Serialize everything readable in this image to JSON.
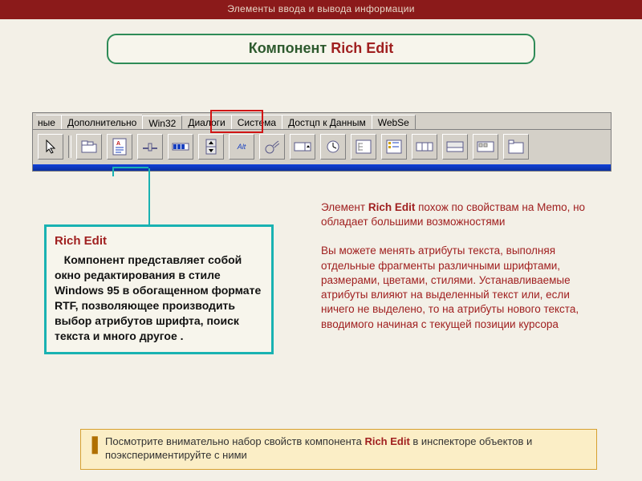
{
  "topbar": "Элементы ввода и вывода информации",
  "title": {
    "part1": "Компонент ",
    "part2": "Rich Edit"
  },
  "tabs": {
    "t0": "ные",
    "t1": "Дополнительно",
    "t2": "Win32",
    "t3": "Диалоги",
    "t4": "Система",
    "t5": "Достцп к Данным",
    "t6": "WebSe"
  },
  "toolbar_icons": [
    "cursor-icon",
    "tab-control-icon",
    "richedit-icon",
    "trackbar-icon",
    "progressbar-icon",
    "updown-icon",
    "hotkey-icon",
    "animate-icon",
    "datetime-icon",
    "monthcal-icon",
    "treeview-icon",
    "listview-icon",
    "header-icon",
    "statusbar-icon",
    "toolbar-icon",
    "pagecontrol-icon"
  ],
  "desc": {
    "heading": "Rich Edit",
    "body": "Компонент представляет собой окно редактирования в стиле Windows 95 в обогащенном формате RTF, позволяющее производить выбор атрибутов шрифта, поиск текста и много другое ."
  },
  "right": {
    "p1a": "Элемент ",
    "p1b": "Rich Edit",
    "p1c": " похож по свойствам на Memo, но обладает большими возможностями",
    "p2": "Вы можете менять атрибуты текста, выполняя отдельные фрагменты различными шрифтами, размерами, цветами, стилями. Устанавливаемые атрибуты влияют на выделенный текст или, если ничего не выделено, то на атрибуты нового текста, вводимого начиная с текущей позиции курсора"
  },
  "note": {
    "t1": "Посмотрите внимательно набор свойств компонента ",
    "t2": "Rich Edit",
    "t3": " в инспекторе объектов и поэкспериментируйте с ними"
  }
}
